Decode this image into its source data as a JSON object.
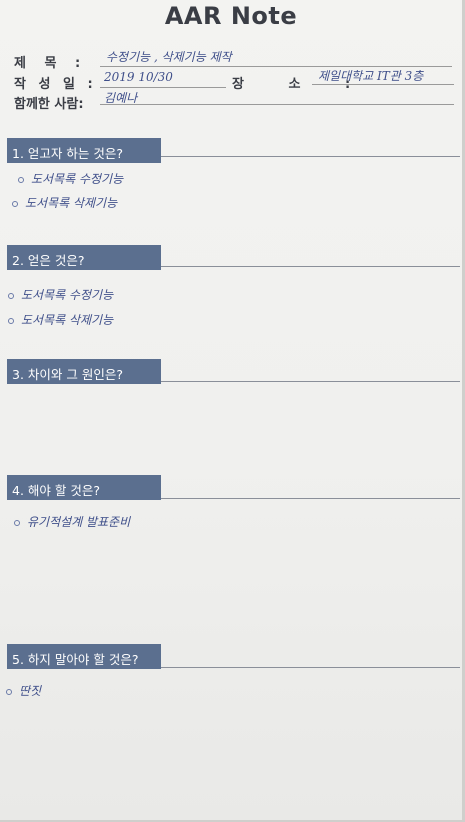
{
  "title": "AAR Note",
  "header": {
    "subject_label": "제 목 :",
    "subject_value": "수정기능 , 삭제기능 제작",
    "date_label": "작 성 일 :",
    "date_value": "2019 10/30",
    "place_label": "장 소 :",
    "place_value": "제일대학교 IT관 3층",
    "with_label": "함께한 사람:",
    "with_value": "김예나"
  },
  "sections": [
    {
      "title": "1. 얻고자 하는 것은?",
      "items": [
        "도서목록 수정기능",
        "도서목록 삭제기능"
      ]
    },
    {
      "title": "2. 얻은 것은?",
      "items": [
        "도서목록 수정기능",
        "도서목록 삭제기능"
      ]
    },
    {
      "title": "3. 차이와 그 원인은?",
      "items": []
    },
    {
      "title": "4. 해야 할 것은?",
      "items": [
        "유기적설계 발표준비"
      ]
    },
    {
      "title": "5. 하지 말아야 할 것은?",
      "items": [
        "딴짓"
      ]
    }
  ]
}
